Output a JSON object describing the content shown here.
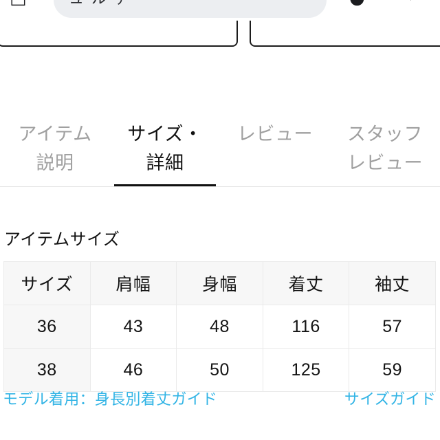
{
  "browser_chrome": {
    "tabs_icon": "tabs-icon",
    "url_text": "ュ ル ァ ・",
    "avatar_icon": "avatar-icon",
    "menu_icon": "chevron-down-icon"
  },
  "cutoff_boxes": {
    "left_label": "",
    "right_label": ""
  },
  "tabs": [
    {
      "label": "アイテム\n説明",
      "active": false
    },
    {
      "label": "サイズ・\n詳細",
      "active": true
    },
    {
      "label": "レビュー",
      "active": false
    },
    {
      "label": "スタッフ\nレビュー",
      "active": false
    }
  ],
  "section": {
    "heading": "アイテムサイズ"
  },
  "size_table": {
    "columns": [
      "サイズ",
      "肩幅",
      "身幅",
      "着丈",
      "袖丈"
    ],
    "rows": [
      [
        "36",
        "43",
        "48",
        "116",
        "57"
      ],
      [
        "38",
        "46",
        "50",
        "125",
        "59"
      ]
    ]
  },
  "links": {
    "model_guide": "モデル着用：身長別着丈ガイド",
    "size_guide": "サイズガイド"
  },
  "colors": {
    "link": "#32b4e5",
    "active_tab_text": "#111111",
    "inactive_tab_text": "#a0a0a0",
    "table_header_bg": "#f7f7f7",
    "table_border": "#eaeaea"
  }
}
